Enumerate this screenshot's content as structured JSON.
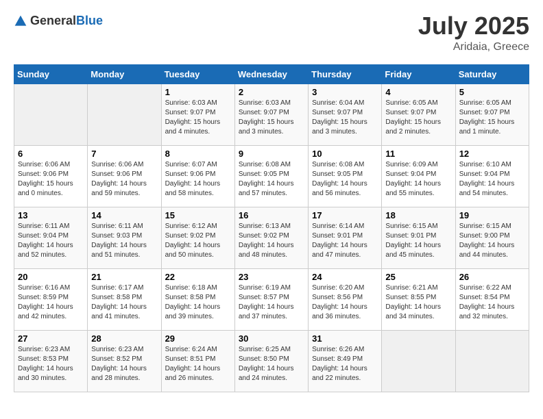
{
  "header": {
    "logo_general": "General",
    "logo_blue": "Blue",
    "month_year": "July 2025",
    "location": "Aridaia, Greece"
  },
  "weekdays": [
    "Sunday",
    "Monday",
    "Tuesday",
    "Wednesday",
    "Thursday",
    "Friday",
    "Saturday"
  ],
  "weeks": [
    [
      {
        "day": "",
        "info": ""
      },
      {
        "day": "",
        "info": ""
      },
      {
        "day": "1",
        "info": "Sunrise: 6:03 AM\nSunset: 9:07 PM\nDaylight: 15 hours and 4 minutes."
      },
      {
        "day": "2",
        "info": "Sunrise: 6:03 AM\nSunset: 9:07 PM\nDaylight: 15 hours and 3 minutes."
      },
      {
        "day": "3",
        "info": "Sunrise: 6:04 AM\nSunset: 9:07 PM\nDaylight: 15 hours and 3 minutes."
      },
      {
        "day": "4",
        "info": "Sunrise: 6:05 AM\nSunset: 9:07 PM\nDaylight: 15 hours and 2 minutes."
      },
      {
        "day": "5",
        "info": "Sunrise: 6:05 AM\nSunset: 9:07 PM\nDaylight: 15 hours and 1 minute."
      }
    ],
    [
      {
        "day": "6",
        "info": "Sunrise: 6:06 AM\nSunset: 9:06 PM\nDaylight: 15 hours and 0 minutes."
      },
      {
        "day": "7",
        "info": "Sunrise: 6:06 AM\nSunset: 9:06 PM\nDaylight: 14 hours and 59 minutes."
      },
      {
        "day": "8",
        "info": "Sunrise: 6:07 AM\nSunset: 9:06 PM\nDaylight: 14 hours and 58 minutes."
      },
      {
        "day": "9",
        "info": "Sunrise: 6:08 AM\nSunset: 9:05 PM\nDaylight: 14 hours and 57 minutes."
      },
      {
        "day": "10",
        "info": "Sunrise: 6:08 AM\nSunset: 9:05 PM\nDaylight: 14 hours and 56 minutes."
      },
      {
        "day": "11",
        "info": "Sunrise: 6:09 AM\nSunset: 9:04 PM\nDaylight: 14 hours and 55 minutes."
      },
      {
        "day": "12",
        "info": "Sunrise: 6:10 AM\nSunset: 9:04 PM\nDaylight: 14 hours and 54 minutes."
      }
    ],
    [
      {
        "day": "13",
        "info": "Sunrise: 6:11 AM\nSunset: 9:04 PM\nDaylight: 14 hours and 52 minutes."
      },
      {
        "day": "14",
        "info": "Sunrise: 6:11 AM\nSunset: 9:03 PM\nDaylight: 14 hours and 51 minutes."
      },
      {
        "day": "15",
        "info": "Sunrise: 6:12 AM\nSunset: 9:02 PM\nDaylight: 14 hours and 50 minutes."
      },
      {
        "day": "16",
        "info": "Sunrise: 6:13 AM\nSunset: 9:02 PM\nDaylight: 14 hours and 48 minutes."
      },
      {
        "day": "17",
        "info": "Sunrise: 6:14 AM\nSunset: 9:01 PM\nDaylight: 14 hours and 47 minutes."
      },
      {
        "day": "18",
        "info": "Sunrise: 6:15 AM\nSunset: 9:01 PM\nDaylight: 14 hours and 45 minutes."
      },
      {
        "day": "19",
        "info": "Sunrise: 6:15 AM\nSunset: 9:00 PM\nDaylight: 14 hours and 44 minutes."
      }
    ],
    [
      {
        "day": "20",
        "info": "Sunrise: 6:16 AM\nSunset: 8:59 PM\nDaylight: 14 hours and 42 minutes."
      },
      {
        "day": "21",
        "info": "Sunrise: 6:17 AM\nSunset: 8:58 PM\nDaylight: 14 hours and 41 minutes."
      },
      {
        "day": "22",
        "info": "Sunrise: 6:18 AM\nSunset: 8:58 PM\nDaylight: 14 hours and 39 minutes."
      },
      {
        "day": "23",
        "info": "Sunrise: 6:19 AM\nSunset: 8:57 PM\nDaylight: 14 hours and 37 minutes."
      },
      {
        "day": "24",
        "info": "Sunrise: 6:20 AM\nSunset: 8:56 PM\nDaylight: 14 hours and 36 minutes."
      },
      {
        "day": "25",
        "info": "Sunrise: 6:21 AM\nSunset: 8:55 PM\nDaylight: 14 hours and 34 minutes."
      },
      {
        "day": "26",
        "info": "Sunrise: 6:22 AM\nSunset: 8:54 PM\nDaylight: 14 hours and 32 minutes."
      }
    ],
    [
      {
        "day": "27",
        "info": "Sunrise: 6:23 AM\nSunset: 8:53 PM\nDaylight: 14 hours and 30 minutes."
      },
      {
        "day": "28",
        "info": "Sunrise: 6:23 AM\nSunset: 8:52 PM\nDaylight: 14 hours and 28 minutes."
      },
      {
        "day": "29",
        "info": "Sunrise: 6:24 AM\nSunset: 8:51 PM\nDaylight: 14 hours and 26 minutes."
      },
      {
        "day": "30",
        "info": "Sunrise: 6:25 AM\nSunset: 8:50 PM\nDaylight: 14 hours and 24 minutes."
      },
      {
        "day": "31",
        "info": "Sunrise: 6:26 AM\nSunset: 8:49 PM\nDaylight: 14 hours and 22 minutes."
      },
      {
        "day": "",
        "info": ""
      },
      {
        "day": "",
        "info": ""
      }
    ]
  ]
}
